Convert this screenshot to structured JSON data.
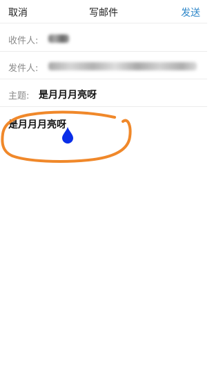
{
  "navbar": {
    "cancel_label": "取消",
    "title": "写邮件",
    "send_label": "发送"
  },
  "fields": {
    "to_label": "收件人:",
    "from_label": "发件人:",
    "subject_label": "主题:",
    "subject_value": "是月月月亮呀"
  },
  "body": {
    "text": "是月月月亮呀"
  },
  "colors": {
    "accent": "#2d86c8",
    "annotation": "#f0882a",
    "cursor_handle": "#0a2ee8"
  }
}
